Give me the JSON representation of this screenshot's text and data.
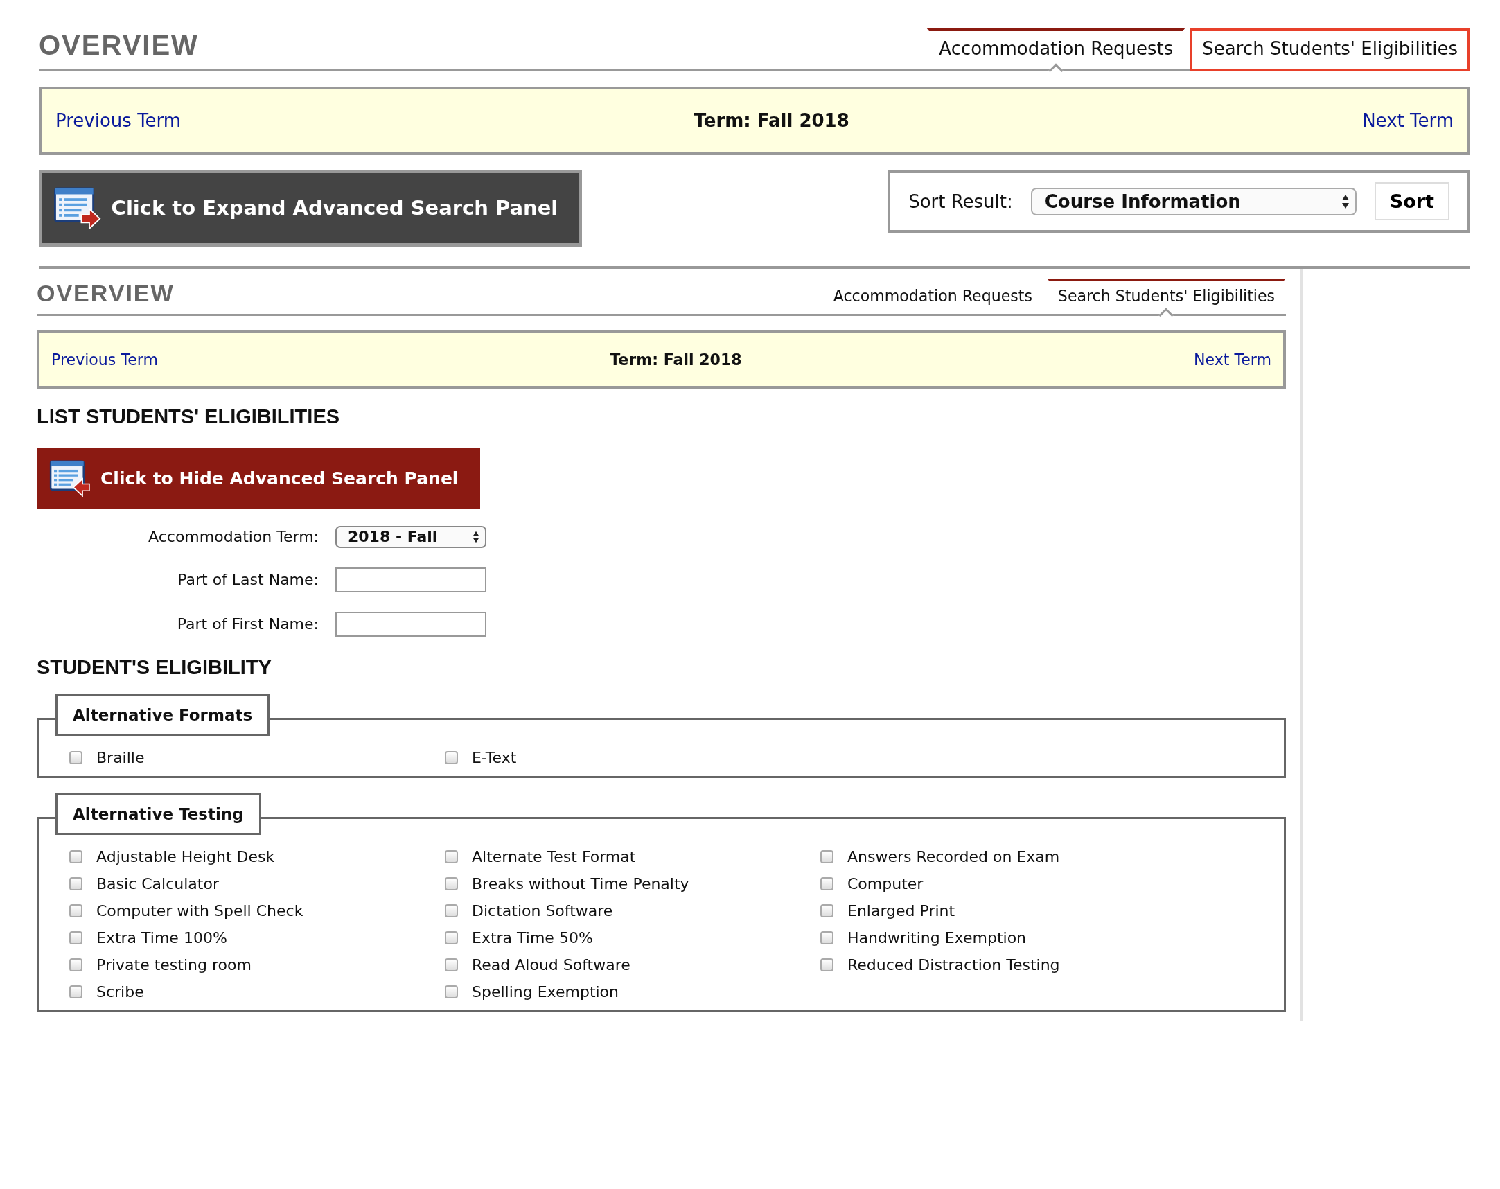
{
  "top": {
    "title": "OVERVIEW",
    "tabs": [
      {
        "label": "Accommodation Requests",
        "selected": true,
        "highlighted": false
      },
      {
        "label": "Search Students' Eligibilities",
        "selected": false,
        "highlighted": true
      }
    ],
    "term_bar": {
      "previous": "Previous Term",
      "term": "Term: Fall 2018",
      "next": "Next Term"
    },
    "panel_button": {
      "label": "Click to Expand Advanced Search Panel",
      "kind": "expand"
    },
    "sort": {
      "label": "Sort Result:",
      "value": "Course Information",
      "button": "Sort"
    }
  },
  "bottom": {
    "title": "OVERVIEW",
    "tabs": [
      {
        "label": "Accommodation Requests",
        "selected": false,
        "highlighted": false
      },
      {
        "label": "Search Students' Eligibilities",
        "selected": true,
        "highlighted": false
      }
    ],
    "term_bar": {
      "previous": "Previous Term",
      "term": "Term: Fall 2018",
      "next": "Next Term"
    },
    "list_heading": "LIST STUDENTS' ELIGIBILITIES",
    "panel_button": {
      "label": "Click to Hide Advanced Search Panel",
      "kind": "hide"
    },
    "form": [
      {
        "label": "Accommodation Term:",
        "kind": "select",
        "value": "2018 - Fall"
      },
      {
        "label": "Part of Last Name:",
        "kind": "text"
      },
      {
        "label": "Part of First Name:",
        "kind": "text"
      }
    ],
    "eligibility_heading": "STUDENT'S ELIGIBILITY",
    "groups": [
      {
        "legend": "Alternative Formats",
        "options": [
          {
            "label": "Braille",
            "checked": false
          },
          {
            "label": "E-Text",
            "checked": false
          }
        ]
      },
      {
        "legend": "Alternative Testing",
        "options": [
          {
            "label": "Adjustable Height Desk",
            "checked": false
          },
          {
            "label": "Alternate Test Format",
            "checked": false
          },
          {
            "label": "Answers Recorded on Exam",
            "checked": false
          },
          {
            "label": "Basic Calculator",
            "checked": false
          },
          {
            "label": "Breaks without Time Penalty",
            "checked": false
          },
          {
            "label": "Computer",
            "checked": false
          },
          {
            "label": "Computer with Spell Check",
            "checked": false
          },
          {
            "label": "Dictation Software",
            "checked": false
          },
          {
            "label": "Enlarged Print",
            "checked": false
          },
          {
            "label": "Extra Time 100%",
            "checked": false
          },
          {
            "label": "Extra Time 50%",
            "checked": false
          },
          {
            "label": "Handwriting Exemption",
            "checked": false
          },
          {
            "label": "Private testing room",
            "checked": false
          },
          {
            "label": "Read Aloud Software",
            "checked": false
          },
          {
            "label": "Reduced Distraction Testing",
            "checked": false
          },
          {
            "label": "Scribe",
            "checked": false
          },
          {
            "label": "Spelling Exemption",
            "checked": false
          }
        ]
      }
    ]
  }
}
